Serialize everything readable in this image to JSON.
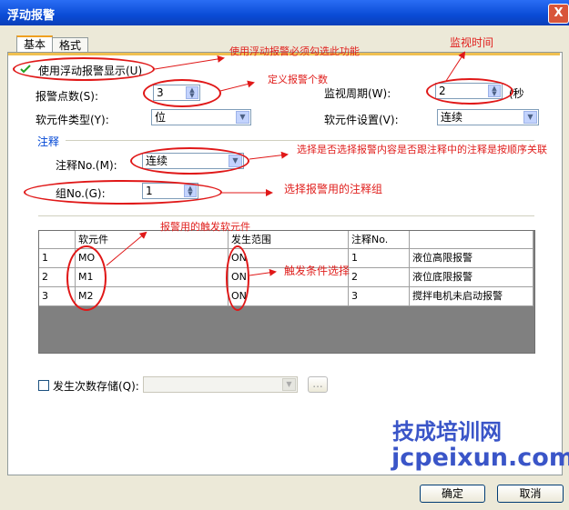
{
  "window": {
    "title": "浮动报警",
    "close_label": "X"
  },
  "tabs": [
    {
      "label": "基本"
    },
    {
      "label": "格式"
    }
  ],
  "use_float_alarm": {
    "label": "使用浮动报警显示(U)",
    "checked": true
  },
  "alarm_points": {
    "label": "报警点数(S):",
    "value": "3"
  },
  "monitor_period": {
    "label": "监视周期(W):",
    "value": "2",
    "unit": "(秒"
  },
  "device_type": {
    "label": "软元件类型(Y):",
    "value": "位"
  },
  "device_setting": {
    "label": "软元件设置(V):",
    "value": "连续"
  },
  "comment_section": {
    "title": "注释"
  },
  "comment_no": {
    "label": "注释No.(M):",
    "value": "连续"
  },
  "group_no": {
    "label": "组No.(G):",
    "value": "1"
  },
  "table": {
    "headers": [
      "",
      "软元件",
      "发生范围",
      "注释No.",
      ""
    ],
    "rows": [
      [
        "1",
        "MO",
        "ON",
        "1",
        "液位高限报警"
      ],
      [
        "2",
        "M1",
        "ON",
        "2",
        "液位底限报警"
      ],
      [
        "3",
        "M2",
        "ON",
        "3",
        "搅拌电机未启动报警"
      ]
    ]
  },
  "occurrence_storage": {
    "label": "发生次数存储(Q):",
    "checked": false,
    "browse_label": "..."
  },
  "buttons": {
    "ok": "确定",
    "cancel": "取消"
  },
  "annotations": {
    "a1": "使用浮动报警必须勾选此功能",
    "a2": "监视时间",
    "a3": "定义报警个数",
    "a4": "选择是否选择报警内容是否跟注释中的注释是按顺序关联",
    "a5": "选择报警用的注释组",
    "a6": "报警用的触发软元件",
    "a7": "触发条件选择"
  },
  "watermark": {
    "line1": "技成培训网",
    "line2": "jcpeixun.com"
  },
  "colors": {
    "annotation": "#e0201e",
    "titlebar": "#0a4bd6",
    "watermark": "#3a55c8"
  }
}
